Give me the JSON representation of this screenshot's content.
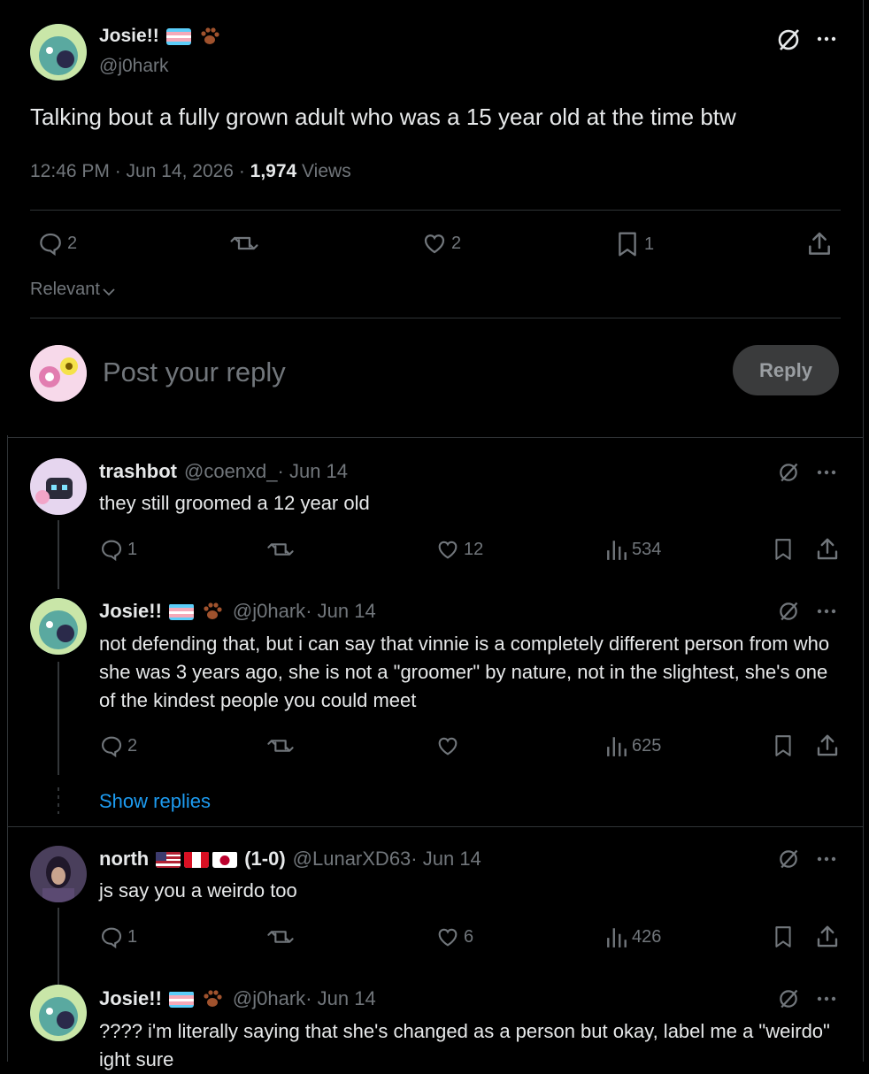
{
  "main_post": {
    "display_name": "Josie!!",
    "handle": "@j0hark",
    "text": "Talking bout a fully grown adult who was a 15 year old at the time btw",
    "time": "12:46 PM · Jun 14, 2026 · ",
    "views_count": "1,974",
    "views_label": " Views",
    "replies": "2",
    "likes": "2",
    "bookmarks": "1"
  },
  "sort": {
    "label": "Relevant"
  },
  "composer": {
    "placeholder": "Post your reply",
    "button": "Reply"
  },
  "replies": [
    {
      "display_name": "trashbot",
      "handle": "@coenxd_",
      "date": " · Jun 14",
      "text": "they still groomed a 12 year old",
      "replies": "1",
      "likes": "12",
      "views": "534"
    },
    {
      "display_name": "Josie!!",
      "handle": "@j0hark",
      "date": " · Jun 14",
      "text": "not defending that, but i can say that vinnie is a completely different person from who she was 3 years ago, she is not a \"groomer\" by nature, not in the slightest, she's one of the kindest people you could meet",
      "replies": "2",
      "likes": "",
      "views": "625"
    },
    {
      "display_name": "north",
      "tag": "(1-0)",
      "handle": "@LunarXD63",
      "date": " · Jun 14",
      "text": "js say you a weirdo too",
      "replies": "1",
      "likes": "6",
      "views": "426"
    },
    {
      "display_name": "Josie!!",
      "handle": "@j0hark",
      "date": " · Jun 14",
      "text": "???? i'm literally saying that she's changed as a person but okay, label me a \"weirdo\" ight sure"
    }
  ],
  "show_replies": "Show replies",
  "colors": {
    "background": "#000000",
    "text": "#e7e9ea",
    "muted": "#71767b",
    "link": "#1d9bf0",
    "divider": "#2f3336"
  }
}
